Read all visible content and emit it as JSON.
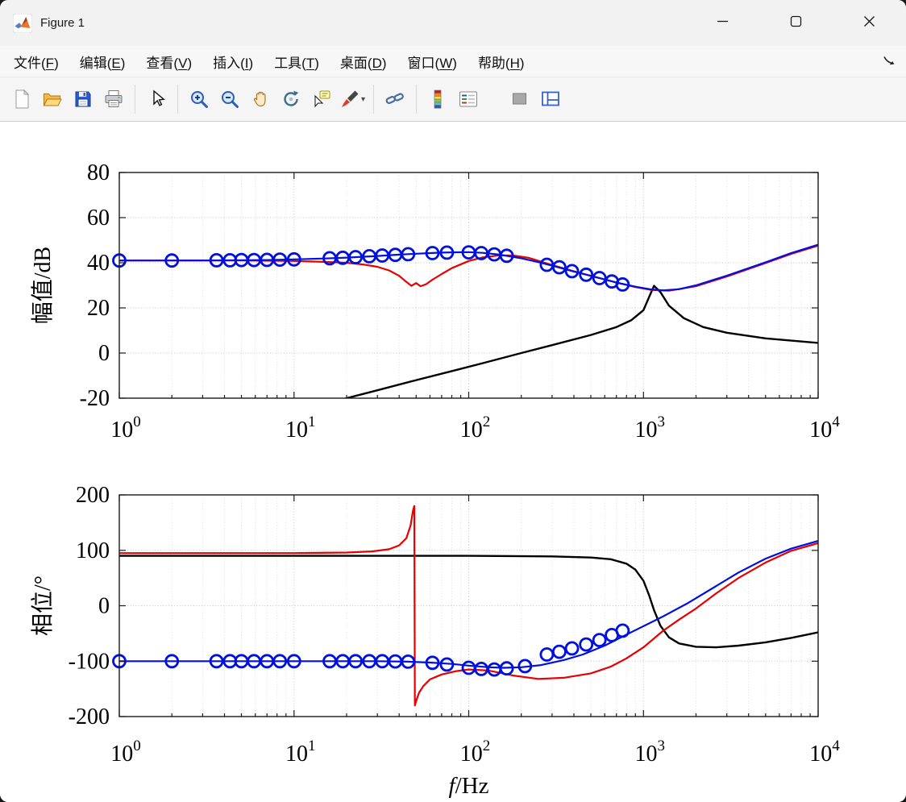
{
  "window": {
    "title": "Figure 1",
    "controls": [
      "minimize",
      "maximize",
      "close"
    ]
  },
  "menu": {
    "items": [
      "文件(F)",
      "编辑(E)",
      "查看(V)",
      "插入(I)",
      "工具(T)",
      "桌面(D)",
      "窗口(W)",
      "帮助(H)"
    ],
    "corner_icon": "dock-arrow"
  },
  "toolbar": {
    "groups": [
      [
        "new-figure",
        "open-file",
        "save-figure",
        "print-figure"
      ],
      [
        "pointer"
      ],
      [
        "zoom-in",
        "zoom-out",
        "pan",
        "rotate-3d",
        "data-cursor",
        "brush"
      ],
      [
        "link-plot"
      ],
      [
        "insert-colorbar",
        "insert-legend"
      ],
      [
        "hide-plot-tools",
        "show-plot-tools"
      ]
    ]
  },
  "chart_data": [
    {
      "name": "magnitude-plot",
      "type": "line",
      "xscale": "log",
      "xlim": [
        1,
        10000
      ],
      "ylim": [
        -20,
        80
      ],
      "xticks": {
        "values": [
          1,
          10,
          100,
          1000,
          10000
        ],
        "labels": [
          "10^0",
          "10^1",
          "10^2",
          "10^3",
          "10^4"
        ]
      },
      "yticks": [
        80,
        60,
        40,
        20,
        0,
        -20
      ],
      "ylabel": "幅值/dB",
      "xlabel": "",
      "grid": true,
      "series": [
        {
          "name": "black-curve",
          "color": "#000000",
          "width": 2.4,
          "x": [
            14,
            20,
            30,
            50,
            80,
            120,
            200,
            300,
            500,
            700,
            850,
            1000,
            1080,
            1150,
            1250,
            1400,
            1700,
            2200,
            3000,
            5000,
            10000
          ],
          "y": [
            -23,
            -20,
            -16.5,
            -12,
            -8,
            -4.5,
            0,
            3.5,
            8,
            11.5,
            14.5,
            19,
            25,
            29.8,
            27,
            21,
            15.5,
            11.5,
            9,
            6.5,
            4.5
          ]
        },
        {
          "name": "red-curve",
          "color": "#e60000",
          "width": 2.2,
          "x": [
            1,
            2,
            5,
            10,
            15,
            20,
            25,
            30,
            35,
            40,
            44,
            47,
            50,
            53,
            57,
            62,
            70,
            80,
            100,
            120,
            150,
            180,
            220,
            300,
            400,
            500,
            700,
            900,
            1100,
            1400,
            2000,
            3000,
            5000,
            7000,
            10000
          ],
          "y": [
            41,
            41,
            41,
            40.8,
            40.4,
            40,
            39.2,
            38.2,
            36.6,
            34.2,
            31.5,
            29.8,
            31,
            29.6,
            30.5,
            32.5,
            35,
            37.6,
            40.8,
            42.4,
            43.3,
            43.2,
            42.2,
            39,
            36.2,
            34.2,
            31.2,
            29.2,
            28,
            27.6,
            29.6,
            33.9,
            39.9,
            43.9,
            47.6
          ]
        },
        {
          "name": "blue-curve",
          "color": "#0010dd",
          "width": 2.2,
          "x": [
            1,
            2,
            3,
            5,
            7,
            10,
            15,
            20,
            30,
            40,
            50,
            60,
            70,
            85,
            100,
            120,
            150,
            200,
            250,
            300,
            400,
            500,
            700,
            900,
            1100,
            1300,
            1600,
            2000,
            3000,
            5000,
            7000,
            10000
          ],
          "y": [
            41,
            41,
            41.05,
            41.1,
            41.2,
            41.5,
            41.9,
            42.3,
            43,
            43.6,
            44,
            44.3,
            44.5,
            44.65,
            44.7,
            44.4,
            43.6,
            42,
            40.3,
            38.7,
            36.1,
            34.2,
            31.3,
            29.4,
            28.2,
            27.8,
            28.3,
            30,
            34.3,
            40.2,
            44.3,
            48
          ]
        },
        {
          "name": "blue-circle-markers",
          "color": "#0010dd",
          "marker": "circle",
          "width": 2.8,
          "x": [
            1,
            2,
            3.6,
            4.3,
            5,
            5.9,
            7,
            8.3,
            10,
            16,
            19,
            22.5,
            27,
            32,
            38,
            45,
            62,
            75,
            100,
            118,
            140,
            165,
            280,
            330,
            390,
            470,
            560,
            660,
            760
          ],
          "y": [
            41,
            41,
            41.1,
            41.1,
            41.2,
            41.2,
            41.3,
            41.4,
            41.5,
            42,
            42.2,
            42.5,
            42.9,
            43.2,
            43.5,
            43.8,
            44.3,
            44.5,
            44.6,
            44.3,
            43.7,
            43.1,
            39.1,
            38,
            36.3,
            34.7,
            33.2,
            31.7,
            30.4
          ]
        }
      ]
    },
    {
      "name": "phase-plot",
      "type": "line",
      "xscale": "log",
      "xlim": [
        1,
        10000
      ],
      "ylim": [
        -200,
        200
      ],
      "xticks": {
        "values": [
          1,
          10,
          100,
          1000,
          10000
        ],
        "labels": [
          "10^0",
          "10^1",
          "10^2",
          "10^3",
          "10^4"
        ]
      },
      "yticks": [
        200,
        100,
        0,
        -100,
        -200
      ],
      "ylabel": "相位/°",
      "xlabel": "f/Hz",
      "grid": true,
      "series": [
        {
          "name": "black-curve",
          "color": "#000000",
          "width": 2.4,
          "x": [
            1,
            10,
            100,
            300,
            500,
            650,
            800,
            900,
            1000,
            1080,
            1150,
            1250,
            1400,
            1600,
            2000,
            2600,
            3500,
            5000,
            7000,
            10000
          ],
          "y": [
            90,
            90,
            90,
            89,
            87,
            84,
            76,
            65,
            45,
            18,
            -8,
            -36,
            -57,
            -68,
            -74,
            -75,
            -72,
            -66,
            -58,
            -48
          ]
        },
        {
          "name": "red-curve",
          "color": "#e60000",
          "width": 2.2,
          "x": [
            1,
            3,
            10,
            20,
            28,
            35,
            40,
            44,
            46.5,
            48,
            48.8,
            49.2,
            49.6,
            50.5,
            52,
            55,
            60,
            70,
            85,
            100,
            130,
            180,
            250,
            350,
            500,
            650,
            800,
            1000,
            1300,
            1600,
            2000,
            2600,
            3500,
            5000,
            7000,
            10000
          ],
          "y": [
            95,
            95,
            95,
            96,
            98,
            102,
            109,
            122,
            145,
            172,
            180,
            -180,
            -176,
            -168,
            -157,
            -145,
            -133,
            -124,
            -118,
            -115,
            -117,
            -126,
            -132,
            -130,
            -122,
            -110,
            -95,
            -75,
            -45,
            -25,
            -5,
            22,
            50,
            78,
            99,
            113
          ]
        },
        {
          "name": "blue-curve",
          "color": "#0010dd",
          "width": 2.2,
          "x": [
            1,
            2,
            5,
            10,
            20,
            30,
            45,
            60,
            80,
            100,
            130,
            160,
            200,
            260,
            350,
            450,
            600,
            800,
            1000,
            1300,
            1800,
            2500,
            3500,
            5000,
            7000,
            10000
          ],
          "y": [
            -100,
            -100,
            -100,
            -100,
            -100,
            -100,
            -101,
            -102.5,
            -105,
            -108,
            -111,
            -112,
            -111,
            -107,
            -98,
            -88,
            -72,
            -52,
            -37,
            -19,
            5,
            32,
            60,
            85,
            103,
            117
          ]
        },
        {
          "name": "blue-circle-markers",
          "color": "#0010dd",
          "marker": "circle",
          "width": 2.8,
          "x": [
            1,
            2,
            3.6,
            4.3,
            5,
            5.9,
            7,
            8.3,
            10,
            16,
            19,
            22.5,
            27,
            32,
            38,
            45,
            62,
            75,
            100,
            118,
            140,
            165,
            210,
            280,
            330,
            390,
            470,
            560,
            660,
            760
          ],
          "y": [
            -100,
            -100,
            -100,
            -100,
            -100,
            -100,
            -100,
            -100,
            -100,
            -100,
            -100,
            -100,
            -100,
            -100,
            -100.5,
            -101,
            -103,
            -106,
            -112,
            -114,
            -115,
            -113,
            -109,
            -88,
            -83,
            -77,
            -70,
            -62,
            -53,
            -45
          ]
        }
      ]
    }
  ]
}
